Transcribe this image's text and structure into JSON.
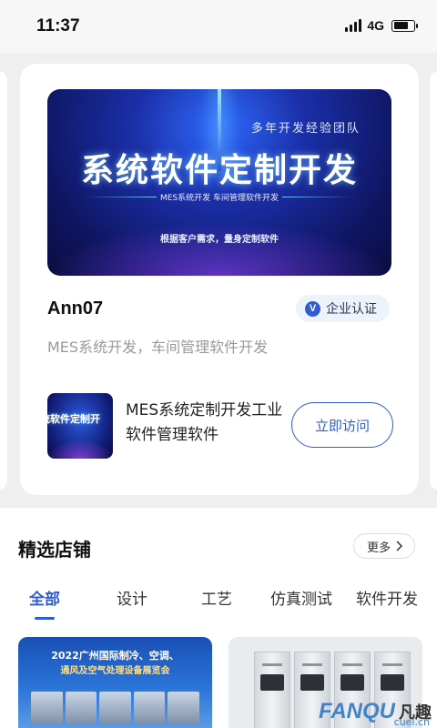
{
  "status_bar": {
    "time": "11:37",
    "network": "4G"
  },
  "featured_card": {
    "banner": {
      "subtitle": "多年开发经验团队",
      "headline": "系统软件定制开发",
      "tags": "MES系统开发    车间管理软件开发",
      "slogan": "根据客户需求，量身定制软件"
    },
    "shop_name": "Ann07",
    "certification_label": "企业认证",
    "certification_icon_letter": "V",
    "shop_description": "MES系统开发，车间管理软件开发",
    "product": {
      "thumbnail_text": "统软件定制开",
      "title": "MES系统定制开发工业软件管理软件",
      "visit_label": "立即访问"
    }
  },
  "section": {
    "title": "精选店铺",
    "more_label": "更多",
    "tabs": [
      {
        "label": "全部",
        "active": true
      },
      {
        "label": "设计",
        "active": false
      },
      {
        "label": "工艺",
        "active": false
      },
      {
        "label": "仿真测试",
        "active": false
      },
      {
        "label": "软件开发",
        "active": false
      }
    ],
    "shop_cards": [
      {
        "image_heading": "2022广州国际制冷、空调、",
        "image_subheading": "通风及空气处理设备展览会"
      },
      {
        "image_heading": ""
      }
    ]
  },
  "watermark": {
    "brand": "FANQU",
    "cn": "凡趣",
    "url": "cuel.cn"
  },
  "colors": {
    "accent": "#2f5bd3",
    "muted_text": "#999999"
  }
}
